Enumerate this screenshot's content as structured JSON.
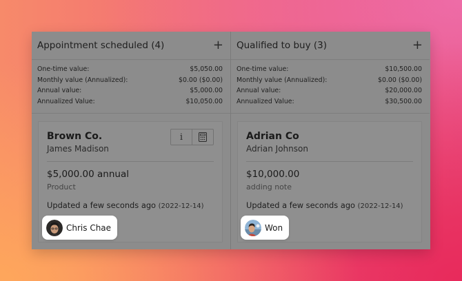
{
  "columns": [
    {
      "title": "Appointment scheduled (4)",
      "summary": [
        {
          "label": "One-time value:",
          "value": "$5,050.00"
        },
        {
          "label": "Monthly value (Annualized):",
          "value": "$0.00 ($0.00)"
        },
        {
          "label": "Annual value:",
          "value": "$5,000.00"
        },
        {
          "label": "Annualized Value:",
          "value": "$10,050.00"
        }
      ],
      "card": {
        "company": "Brown Co.",
        "contact": "James Madison",
        "amount": "$5,000.00 annual",
        "note": "Product",
        "updated": "Updated a few seconds ago",
        "date": "(2022-12-14)",
        "owner": "Chris Chae",
        "tools": {
          "info": "i",
          "calc": "▦"
        }
      }
    },
    {
      "title": "Qualified to buy (3)",
      "summary": [
        {
          "label": "One-time value:",
          "value": "$10,500.00"
        },
        {
          "label": "Monthly value (Annualized):",
          "value": "$0.00 ($0.00)"
        },
        {
          "label": "Annual value:",
          "value": "$20,000.00"
        },
        {
          "label": "Annualized Value:",
          "value": "$30,500.00"
        }
      ],
      "card": {
        "company": "Adrian Co",
        "contact": "Adrian Johnson",
        "amount": "$10,000.00",
        "note": "adding note",
        "updated": "Updated a few seconds ago",
        "date": "(2022-12-14)",
        "owner": "Won"
      }
    }
  ],
  "icons": {
    "add": "+"
  }
}
